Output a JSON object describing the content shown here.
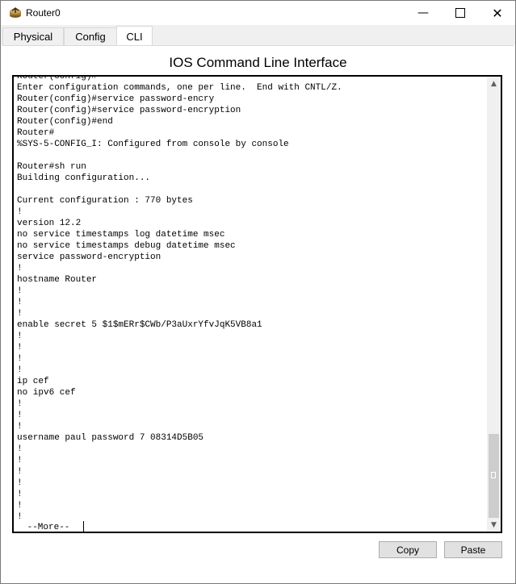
{
  "window": {
    "title": "Router0",
    "icon": "router-icon"
  },
  "window_controls": {
    "minimize": "minimize-icon",
    "maximize": "maximize-icon",
    "close": "close-icon"
  },
  "tabs": [
    {
      "label": "Physical",
      "active": false
    },
    {
      "label": "Config",
      "active": false
    },
    {
      "label": "CLI",
      "active": true
    }
  ],
  "cli": {
    "heading": "IOS Command Line Interface",
    "terminal_lines": [
      "Router(config)#",
      "Enter configuration commands, one per line.  End with CNTL/Z.",
      "Router(config)#service password-encry",
      "Router(config)#service password-encryption",
      "Router(config)#end",
      "Router#",
      "%SYS-5-CONFIG_I: Configured from console by console",
      "",
      "Router#sh run",
      "Building configuration...",
      "",
      "Current configuration : 770 bytes",
      "!",
      "version 12.2",
      "no service timestamps log datetime msec",
      "no service timestamps debug datetime msec",
      "service password-encryption",
      "!",
      "hostname Router",
      "!",
      "!",
      "!",
      "enable secret 5 $1$mERr$CWb/P3aUxrYfvJqK5VB8a1",
      "!",
      "!",
      "!",
      "!",
      "ip cef",
      "no ipv6 cef",
      "!",
      "!",
      "!",
      "username paul password 7 08314D5B05",
      "!",
      "!",
      "!",
      "!",
      "!",
      "!",
      "!"
    ],
    "more_prompt": " --More-- "
  },
  "buttons": {
    "copy": "Copy",
    "paste": "Paste"
  }
}
